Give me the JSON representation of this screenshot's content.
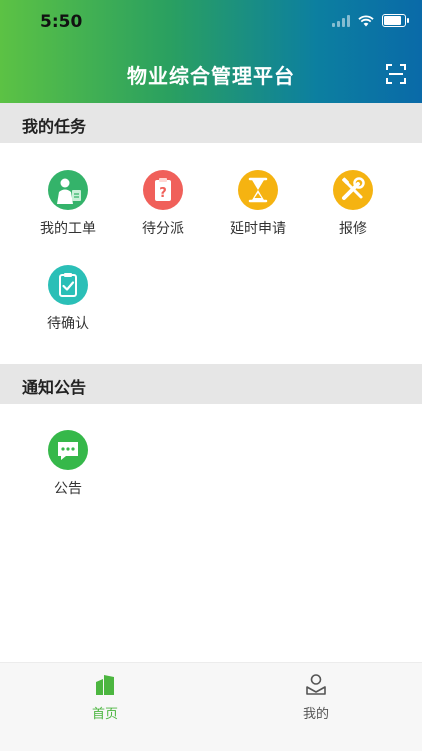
{
  "status_bar": {
    "time": "5:50"
  },
  "header": {
    "title": "物业综合管理平台",
    "scan_icon": "scan-icon"
  },
  "tasks_section": {
    "title": "我的任务",
    "items": [
      {
        "label": "我的工单",
        "icon": "work-order-icon",
        "color": "#34b36a"
      },
      {
        "label": "待分派",
        "icon": "pending-assign-icon",
        "color": "#f0605a"
      },
      {
        "label": "延时申请",
        "icon": "hourglass-icon",
        "color": "#f5b311"
      },
      {
        "label": "报修",
        "icon": "repair-tools-icon",
        "color": "#f5b311"
      },
      {
        "label": "待确认",
        "icon": "clipboard-check-icon",
        "color": "#2bbfb7"
      }
    ]
  },
  "notice_section": {
    "title": "通知公告",
    "items": [
      {
        "label": "公告",
        "icon": "message-icon",
        "color": "#36b84a"
      }
    ]
  },
  "tabbar": {
    "accent": "#4cb640",
    "inactive": "#555555",
    "tabs": [
      {
        "label": "首页",
        "icon": "home-buildings-icon",
        "active": true
      },
      {
        "label": "我的",
        "icon": "profile-icon",
        "active": false
      }
    ]
  }
}
